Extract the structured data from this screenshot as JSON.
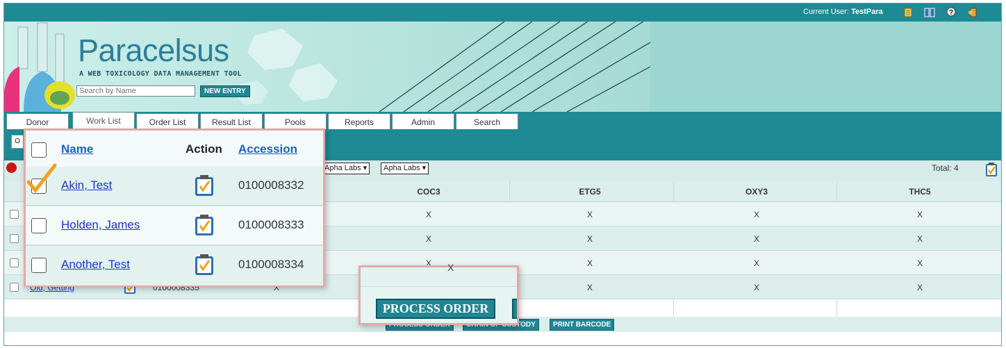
{
  "header": {
    "current_user_label": "Current User:",
    "current_user": "TestPara",
    "icons": [
      "scroll-icon",
      "book-icon",
      "help-icon",
      "logout-icon"
    ]
  },
  "banner": {
    "logo": "Paracelsus",
    "tagline": "A WEB TOXICOLOGY DATA MANAGEMENT TOOL",
    "search_placeholder": "Search by Name",
    "new_entry": "NEW ENTRY"
  },
  "tabs": [
    {
      "label": "Donor"
    },
    {
      "label": "Work List"
    },
    {
      "label": "Order List"
    },
    {
      "label": "Result List"
    },
    {
      "label": "Pools"
    },
    {
      "label": "Reports"
    },
    {
      "label": "Admin"
    },
    {
      "label": "Search"
    }
  ],
  "filters": {
    "lab1": "Apha Labs",
    "lab2": "Apha Labs",
    "total": "Total: 4"
  },
  "grid": {
    "columns": [
      "COC3",
      "ETG5",
      "OXY3",
      "THC5"
    ],
    "rows": [
      {
        "cells": [
          "",
          "",
          "",
          ""
        ]
      },
      {
        "cells": [
          "X",
          "X",
          "X",
          "X"
        ]
      },
      {
        "cells": [
          "X",
          "X",
          "X",
          "X"
        ]
      },
      {
        "cells": [
          "X",
          "X",
          "X",
          "X"
        ]
      },
      {
        "name": "Old, Getting",
        "accession": "0100008335",
        "cells": [
          "X",
          "X",
          "X",
          "X"
        ]
      }
    ]
  },
  "bottom_buttons": {
    "process_order": "PROCESS ORDER",
    "chain_of_custody": "CHAIN OF CUSTODY",
    "print_barcode": "PRINT BARCODE"
  },
  "popup": {
    "headers": {
      "name": "Name",
      "action": "Action",
      "accession": "Accession"
    },
    "rows": [
      {
        "name": "Akin, Test",
        "accession": "0100008332",
        "checked": true
      },
      {
        "name": "Holden, James",
        "accession": "0100008333",
        "checked": false
      },
      {
        "name": "Another, Test",
        "accession": "0100008334",
        "checked": false
      }
    ]
  },
  "zoom_callout": {
    "partial_text": "X",
    "button": "PROCESS ORDER"
  },
  "colors": {
    "teal": "#1e8a93",
    "banner": "#9bd6d0",
    "row_bg": "#dbeeec",
    "link": "#1a35c4",
    "highlight_border": "#e2aaa8",
    "checkmark": "#f0a020"
  }
}
